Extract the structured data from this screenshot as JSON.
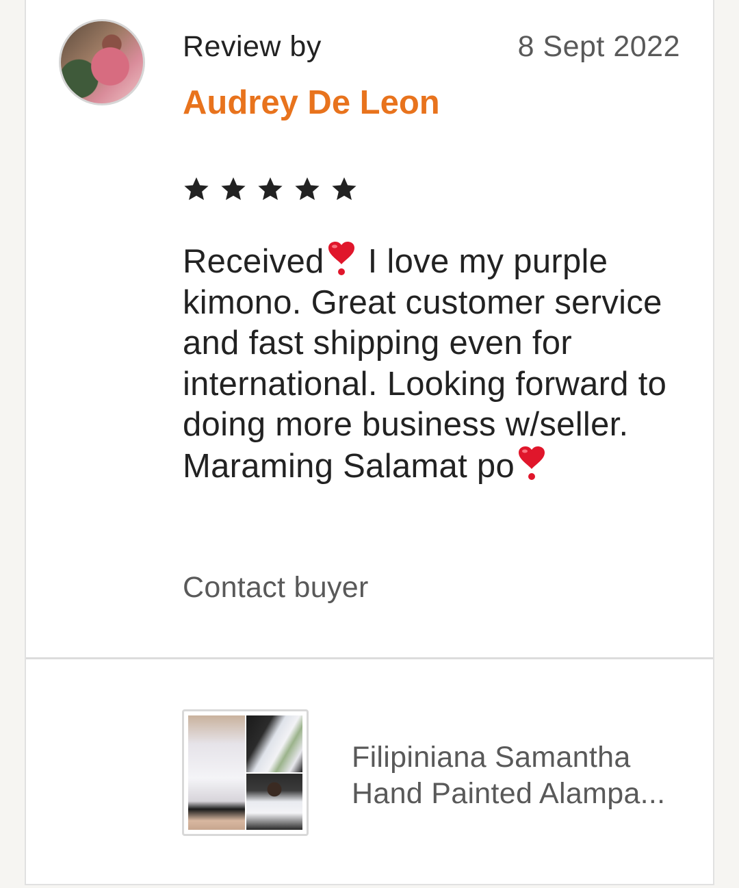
{
  "review": {
    "review_by_label": "Review by",
    "date": "8 Sept 2022",
    "reviewer_name": "Audrey De Leon",
    "rating": 5,
    "rating_max": 5,
    "text_parts": {
      "p1": "Received",
      "p2": " I love my purple kimono. Great customer service and fast shipping even for international. Looking forward to doing more business w/seller. Maraming Salamat po"
    },
    "contact_label": "Contact buyer"
  },
  "product": {
    "title_line1": "Filipiniana Samantha",
    "title_line2": "Hand Painted Alampa..."
  },
  "colors": {
    "reviewer_name": "#e8731d",
    "heart": "#e0162b",
    "star": "#222222"
  }
}
